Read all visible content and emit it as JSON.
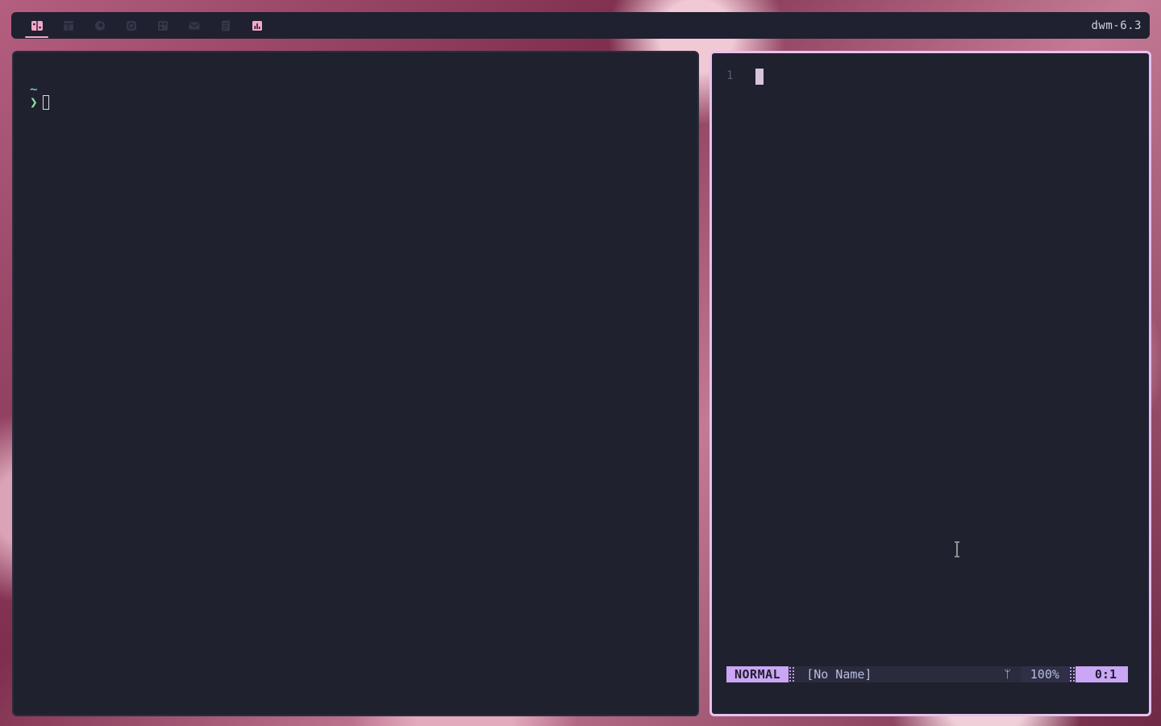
{
  "topbar": {
    "tags": [
      {
        "icon": "split-panel-icon",
        "active": true,
        "color": "#f5a7c7"
      },
      {
        "icon": "browser-window-icon",
        "active": false,
        "color": "#2e3042"
      },
      {
        "icon": "firefox-icon",
        "active": false,
        "color": "#2e3042"
      },
      {
        "icon": "refresh-icon",
        "active": false,
        "color": "#2e3042"
      },
      {
        "icon": "terminal-grid-icon",
        "active": false,
        "color": "#2e3042"
      },
      {
        "icon": "mail-icon",
        "active": false,
        "color": "#2e3042"
      },
      {
        "icon": "document-icon",
        "active": false,
        "color": "#2e3042"
      },
      {
        "icon": "bar-chart-icon",
        "active": false,
        "color": "#f5a7c7"
      }
    ],
    "status_text": "dwm-6.3"
  },
  "terminal": {
    "cwd": "~",
    "prompt_symbol": "❯"
  },
  "editor": {
    "line_number": "1",
    "mode": "NORMAL",
    "filename": "[No Name]",
    "git_icon": "ᛘ",
    "percent": "100%",
    "position": "0:1"
  },
  "colors": {
    "accent": "#caa6f5",
    "focus_border": "#e6c1ef",
    "bar_bg": "#1f2030",
    "window_bg": "#20212f"
  }
}
